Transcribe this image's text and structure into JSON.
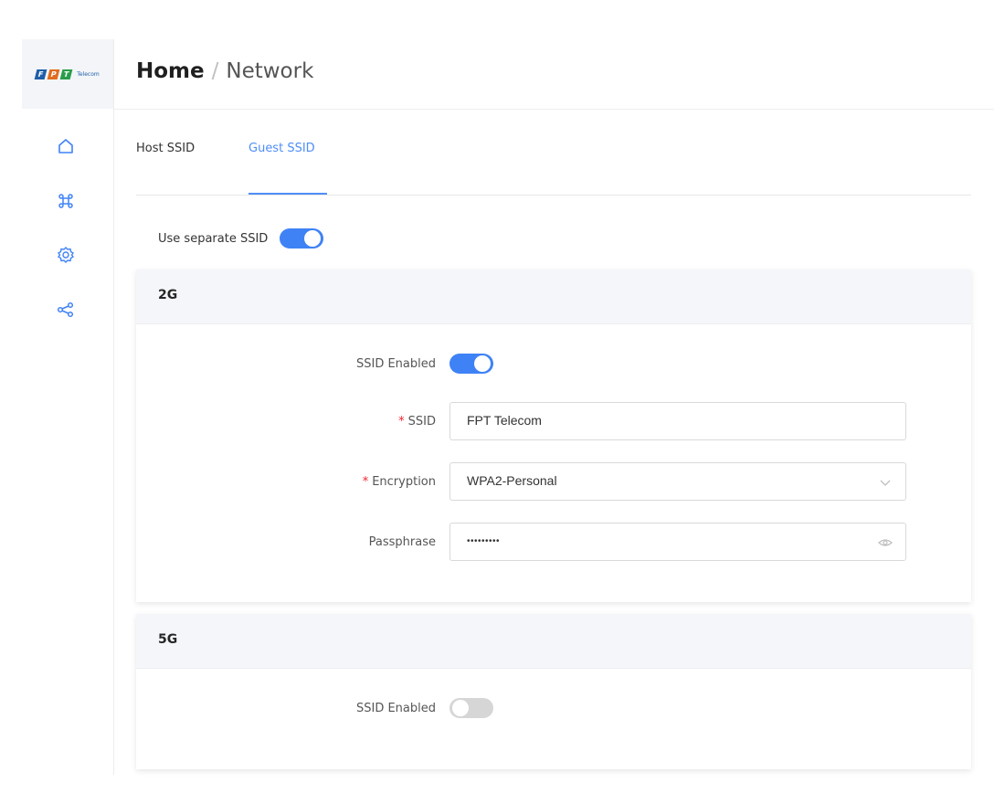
{
  "brand": {
    "logo_letters": [
      "F",
      "P",
      "T"
    ],
    "logo_tagline": "Telecom",
    "colors": [
      "#1f5fa8",
      "#e06c1e",
      "#2a9d4a"
    ]
  },
  "sidebar": {
    "items": [
      {
        "icon": "home-icon"
      },
      {
        "icon": "command-icon"
      },
      {
        "icon": "gear-icon"
      },
      {
        "icon": "share-icon"
      }
    ]
  },
  "breadcrumb": {
    "home": "Home",
    "separator": "/",
    "current": "Network"
  },
  "tabs": [
    {
      "label": "Host SSID",
      "active": false
    },
    {
      "label": "Guest SSID",
      "active": true
    }
  ],
  "use_separate_ssid": {
    "label": "Use separate SSID",
    "enabled": true
  },
  "band_2g": {
    "title": "2G",
    "ssid_enabled_label": "SSID Enabled",
    "ssid_enabled": true,
    "ssid_label": "SSID",
    "ssid_value": "FPT Telecom",
    "encryption_label": "Encryption",
    "encryption_value": "WPA2-Personal",
    "passphrase_label": "Passphrase",
    "passphrase_value": "•••••••••"
  },
  "band_5g": {
    "title": "5G",
    "ssid_enabled_label": "SSID Enabled",
    "ssid_enabled": false
  },
  "required_mark": "*",
  "accent_color": "#3f82f6"
}
